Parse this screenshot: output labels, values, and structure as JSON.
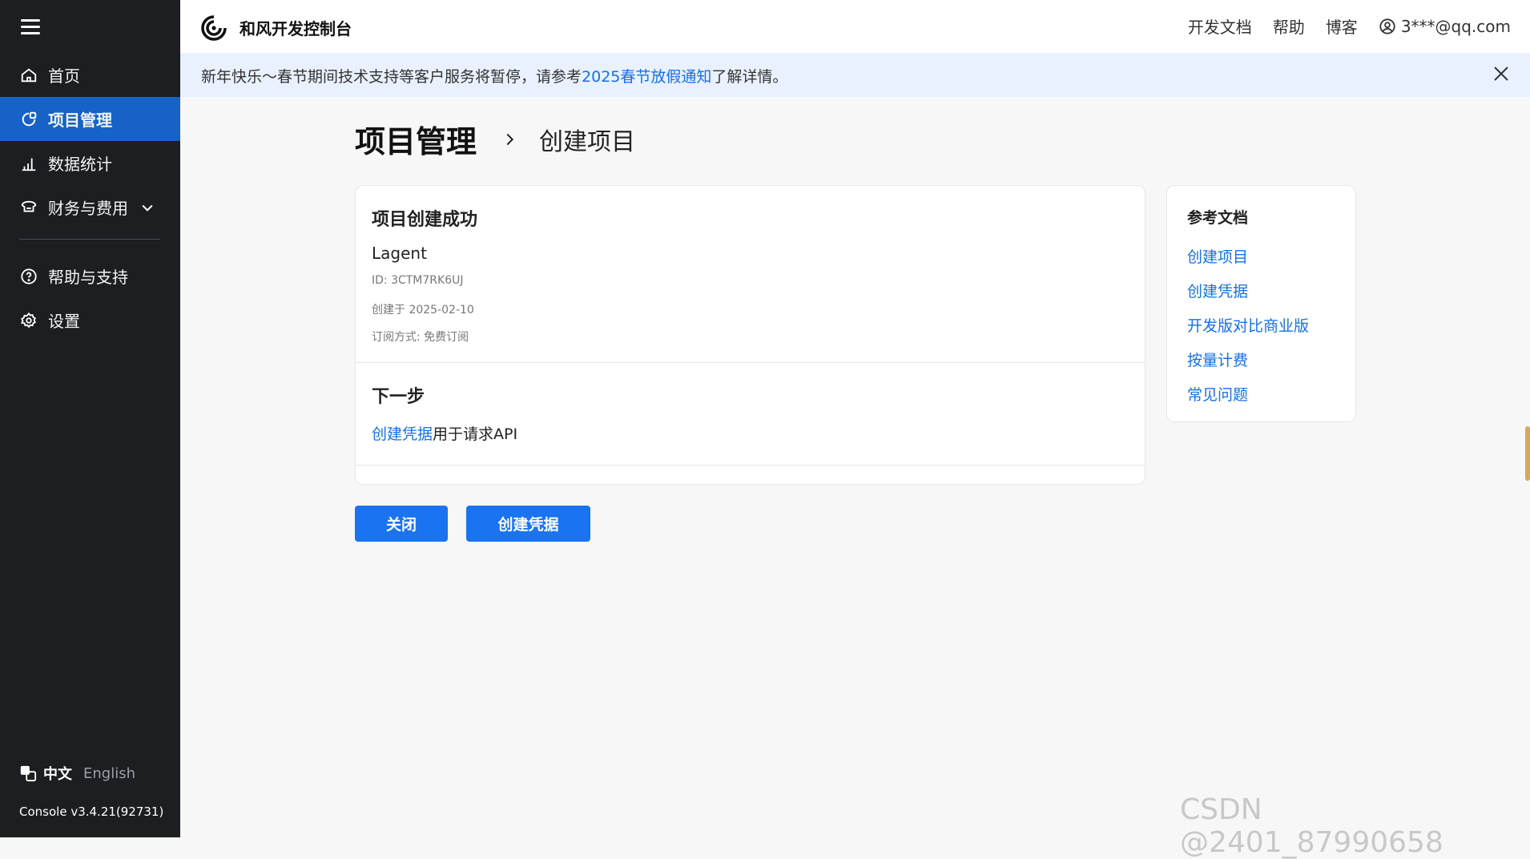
{
  "sidebar": {
    "items": [
      {
        "label": "首页",
        "icon": "home-icon"
      },
      {
        "label": "项目管理",
        "icon": "project-icon",
        "active": true
      },
      {
        "label": "数据统计",
        "icon": "bar-chart-icon"
      },
      {
        "label": "财务与费用",
        "icon": "finance-icon"
      },
      {
        "label": "帮助与支持",
        "icon": "help-circle-icon"
      },
      {
        "label": "设置",
        "icon": "gear-icon"
      }
    ],
    "lang_zh": "中文",
    "lang_en": "English",
    "version": "Console v3.4.21(92731)"
  },
  "topbar": {
    "brand": "和风开发控制台",
    "docs": "开发文档",
    "help": "帮助",
    "blog": "博客",
    "user": "3***@qq.com"
  },
  "notice": {
    "prefix": "新年快乐～春节期间技术支持等客户服务将暂停，请参考",
    "link": "2025春节放假通知",
    "suffix": "了解详情。"
  },
  "page": {
    "title": "项目管理",
    "subtitle": "创建项目"
  },
  "card": {
    "success_title": "项目创建成功",
    "project_name": "Lagent",
    "id": "ID: 3CTM7RK6UJ",
    "created": "创建于 2025-02-10",
    "subscription": "订阅方式: 免费订阅",
    "next_title": "下一步",
    "next_link": "创建凭据",
    "next_text": "用于请求API"
  },
  "refdocs": {
    "title": "参考文档",
    "links": [
      "创建项目",
      "创建凭据",
      "开发版对比商业版",
      "按量计费",
      "常见问题"
    ]
  },
  "buttons": {
    "close": "关闭",
    "create_credential": "创建凭据"
  },
  "watermark": "CSDN @2401_87990658",
  "colors": {
    "sidebar_bg": "#1c1e22",
    "active": "#1662c7",
    "link": "#1570e6",
    "button": "#1a73f0",
    "notice_bg": "#e8f1fd"
  }
}
